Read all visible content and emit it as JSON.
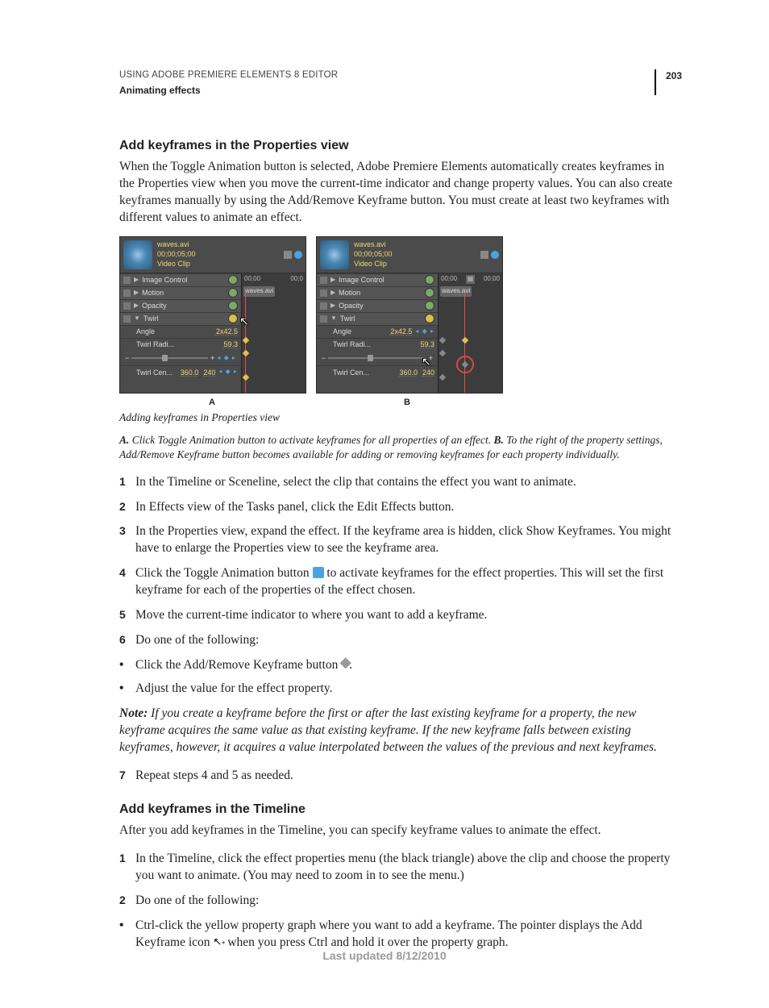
{
  "header": {
    "doc_title": "USING ADOBE PREMIERE ELEMENTS 8 EDITOR",
    "section_title": "Animating effects",
    "page_number": "203"
  },
  "section1": {
    "heading": "Add keyframes in the Properties view",
    "intro": "When the Toggle Animation button is selected, Adobe Premiere Elements automatically creates keyframes in the Properties view when you move the current-time indicator and change property values. You can also create keyframes manually by using the Add/Remove Keyframe button. You must create at least two keyframes with different values to animate an effect."
  },
  "figure": {
    "clip_name": "waves.avi",
    "timecode": "00;00;05;00",
    "clip_type": "Video Clip",
    "tc_left": "00;00",
    "tc_right": "00;0",
    "tab": "waves.avi",
    "rows": {
      "image_control": "Image Control",
      "motion": "Motion",
      "opacity": "Opacity",
      "twirl": "Twirl",
      "angle": "Angle",
      "angle_val": "2x42.5",
      "radius": "Twirl Radi...",
      "radius_val": "59.3",
      "center": "Twirl Cen...",
      "center_val": "360.0",
      "center_val2": "240"
    },
    "label_a": "A",
    "label_b": "B",
    "caption_title": "Adding keyframes in Properties view",
    "caption_a_bold": "A.",
    "caption_a": " Click Toggle Animation button to activate keyframes for all properties of an effect.  ",
    "caption_b_bold": "B.",
    "caption_b": " To the right of the property settings, Add/Remove Keyframe button becomes available for adding or removing keyframes for each property individually."
  },
  "steps1": {
    "s1": "In the Timeline or Sceneline, select the clip that contains the effect you want to animate.",
    "s2": "In Effects view of the Tasks panel, click the Edit Effects button.",
    "s3": "In the Properties view, expand the effect. If the keyframe area is hidden, click Show Keyframes. You might have to enlarge the Properties view to see the keyframe area.",
    "s4_a": "Click the Toggle Animation button ",
    "s4_b": " to activate keyframes for the effect properties. This will set the first keyframe for each of the properties of the effect chosen.",
    "s5": "Move the current-time indicator to where you want to add a keyframe.",
    "s6": "Do one of the following:",
    "b1": "Click the Add/Remove Keyframe button ",
    "b1_suffix": ".",
    "b2": "Adjust the value for the effect property.",
    "note_bold": "Note:",
    "note": " If you create a keyframe before the first or after the last existing keyframe for a property, the new keyframe acquires the same value as that existing keyframe. If the new keyframe falls between existing keyframes, however, it acquires a value interpolated between the values of the previous and next keyframes.",
    "s7": "Repeat steps 4 and 5 as needed."
  },
  "section2": {
    "heading": "Add keyframes in the Timeline",
    "intro": "After you add keyframes in the Timeline, you can specify keyframe values to animate the effect."
  },
  "steps2": {
    "s1": "In the Timeline, click the effect properties menu (the black triangle) above the clip and choose the property you want to animate. (You may need to zoom in to see the menu.)",
    "s2": "Do one of the following:",
    "b1_a": "Ctrl-click the yellow property graph where you want to add a keyframe. The pointer displays the Add Keyframe icon ",
    "b1_b": " when you press Ctrl and hold it over the property graph."
  },
  "footer": "Last updated 8/12/2010"
}
